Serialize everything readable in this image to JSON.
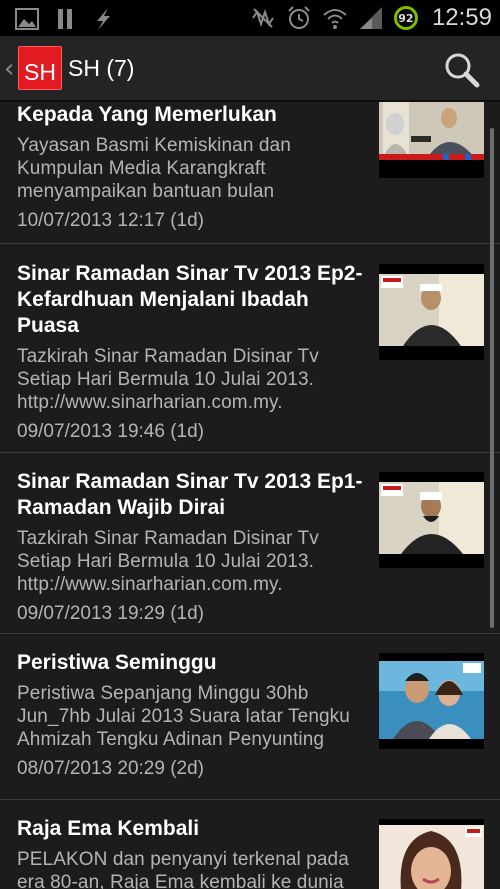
{
  "status_bar": {
    "time": "12:59",
    "battery_level": "92",
    "icons": [
      "image-icon",
      "pause-icon",
      "flash-icon",
      "mute-icon",
      "alarm-icon",
      "wifi-icon",
      "signal-icon",
      "battery-icon"
    ]
  },
  "action_bar": {
    "logo_text": "SH",
    "title": "SH (7)",
    "search_icon": "search-icon"
  },
  "articles": [
    {
      "title": "Kepada Yang Memerlukan",
      "description": "Yayasan Basmi Kemiskinan dan Kumpulan Media Karangkraft menyampaikan bantuan bulan",
      "date": "10/07/2013 12:17 (1d)"
    },
    {
      "title": "Sinar Ramadan Sinar Tv 2013 Ep2-Kefardhuan Menjalani Ibadah Puasa",
      "description": "Tazkirah Sinar Ramadan Disinar Tv Setiap Hari Bermula 10 Julai 2013. http://www.sinarharian.com.my.",
      "date": "09/07/2013 19:46 (1d)"
    },
    {
      "title": "Sinar Ramadan Sinar Tv 2013 Ep1-Ramadan Wajib Dirai",
      "description": "Tazkirah Sinar Ramadan Disinar Tv Setiap Hari Bermula 10 Julai 2013. http://www.sinarharian.com.my.",
      "date": "09/07/2013 19:29 (1d)"
    },
    {
      "title": "Peristiwa Seminggu",
      "description": "Peristiwa Sepanjang Minggu 30hb Jun_7hb Julai 2013 Suara latar Tengku Ahmizah Tengku Adinan Penyunting",
      "date": "08/07/2013 20:29 (2d)"
    },
    {
      "title": "Raja Ema Kembali",
      "description": "PELAKON dan penyanyi terkenal pada era 80-an, Raja Ema kembali ke dunia seni selepas berpuluh tahun",
      "date": ""
    }
  ],
  "colors": {
    "background": "#1c1c1c",
    "action_bar": "#242424",
    "logo_red": "#e21b23",
    "divider": "#3a3a3a",
    "secondary_text": "#b4b4b4",
    "battery_ring": "#7cc000"
  }
}
